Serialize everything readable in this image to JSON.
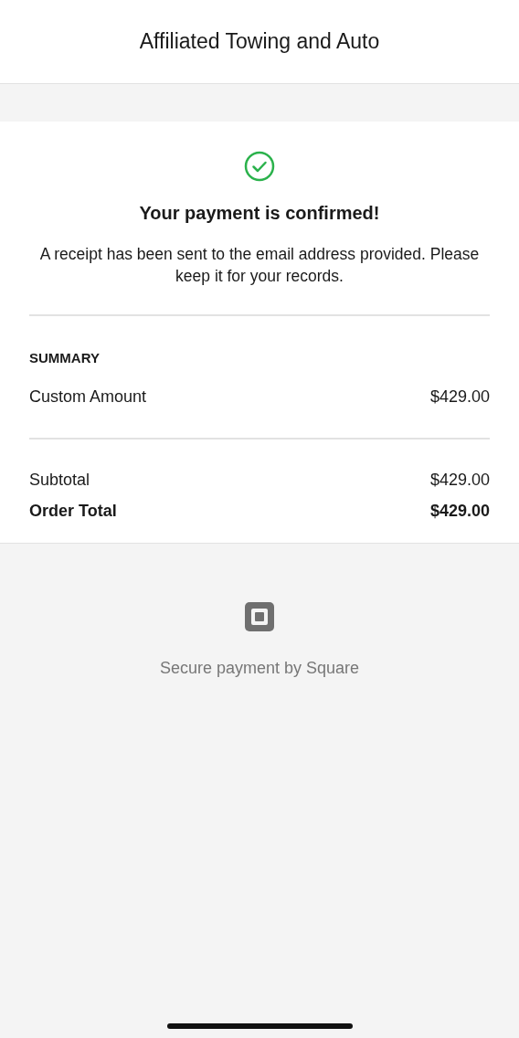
{
  "header": {
    "title": "Affiliated Towing and Auto"
  },
  "confirmation": {
    "title": "Your payment is confirmed!",
    "message": "A receipt has been sent to the email address provided. Please keep it for your records."
  },
  "summary": {
    "heading": "SUMMARY",
    "items": [
      {
        "name": "Custom Amount",
        "amount": "$429.00"
      }
    ]
  },
  "totals": [
    {
      "kind": "subtotal",
      "label": "Subtotal",
      "amount": "$429.00"
    },
    {
      "kind": "total",
      "label": "Order Total",
      "amount": "$429.00"
    }
  ],
  "footer": {
    "text": "Secure payment by Square"
  }
}
